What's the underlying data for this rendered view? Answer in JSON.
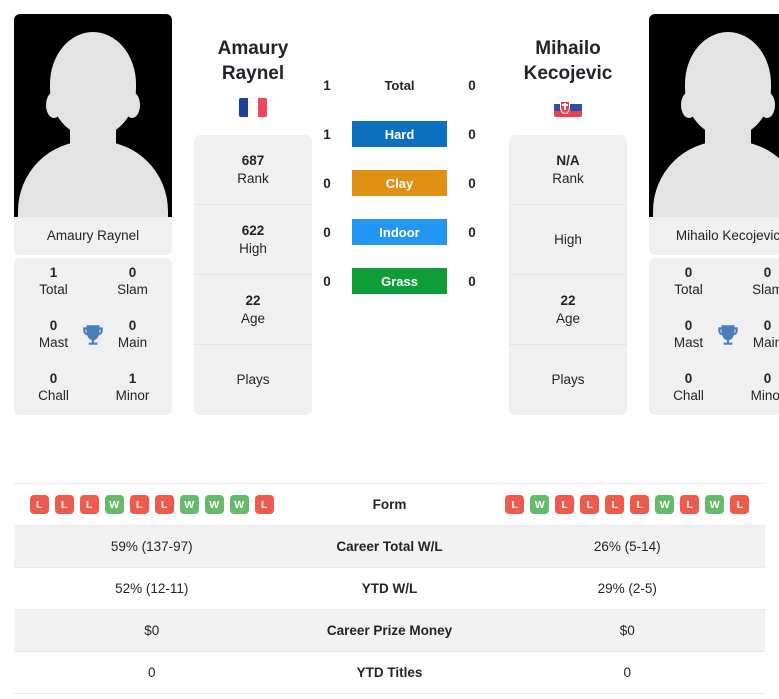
{
  "left_player": {
    "name_full": "Amaury Raynel",
    "name_line1": "Amaury",
    "name_line2": "Raynel",
    "country_flag": "fr-flag-icon",
    "photo_alt": "Amaury Raynel",
    "rank": {
      "value": "687",
      "label": "Rank"
    },
    "high": {
      "value": "622",
      "label": "High"
    },
    "age": {
      "value": "22",
      "label": "Age"
    },
    "plays": {
      "value": "",
      "label": "Plays"
    },
    "titles": {
      "total": {
        "value": "1",
        "label": "Total"
      },
      "slam": {
        "value": "0",
        "label": "Slam"
      },
      "mast": {
        "value": "0",
        "label": "Mast"
      },
      "main": {
        "value": "0",
        "label": "Main"
      },
      "chall": {
        "value": "0",
        "label": "Chall"
      },
      "minor": {
        "value": "1",
        "label": "Minor"
      }
    },
    "form": [
      "L",
      "L",
      "L",
      "W",
      "L",
      "L",
      "W",
      "W",
      "W",
      "L"
    ],
    "career_total_wl": "59% (137-97)",
    "ytd_wl": "52% (12-11)",
    "career_prize_money": "$0",
    "ytd_titles": "0"
  },
  "right_player": {
    "name_full": "Mihailo Kecojevic",
    "name_line1": "Mihailo",
    "name_line2": "Kecojevic",
    "country_flag": "sk-flag-icon",
    "photo_alt": "Mihailo Kecojevic",
    "rank": {
      "value": "N/A",
      "label": "Rank"
    },
    "high": {
      "value": "",
      "label": "High"
    },
    "age": {
      "value": "22",
      "label": "Age"
    },
    "plays": {
      "value": "",
      "label": "Plays"
    },
    "titles": {
      "total": {
        "value": "0",
        "label": "Total"
      },
      "slam": {
        "value": "0",
        "label": "Slam"
      },
      "mast": {
        "value": "0",
        "label": "Mast"
      },
      "main": {
        "value": "0",
        "label": "Main"
      },
      "chall": {
        "value": "0",
        "label": "Chall"
      },
      "minor": {
        "value": "0",
        "label": "Minor"
      }
    },
    "form": [
      "L",
      "W",
      "L",
      "L",
      "L",
      "L",
      "W",
      "L",
      "W",
      "L"
    ],
    "career_total_wl": "26% (5-14)",
    "ytd_wl": "29% (2-5)",
    "career_prize_money": "$0",
    "ytd_titles": "0"
  },
  "head_to_head": [
    {
      "label": "Total",
      "left": "1",
      "right": "0",
      "color": "",
      "style": "plain"
    },
    {
      "label": "Hard",
      "left": "1",
      "right": "0",
      "color": "#0d6fc0",
      "style": "badge"
    },
    {
      "label": "Clay",
      "left": "0",
      "right": "0",
      "color": "#e09112",
      "style": "badge"
    },
    {
      "label": "Indoor",
      "left": "0",
      "right": "0",
      "color": "#2196f3",
      "style": "badge"
    },
    {
      "label": "Grass",
      "left": "0",
      "right": "0",
      "color": "#0f9d3a",
      "style": "badge"
    }
  ],
  "stats_rows": [
    {
      "label": "Form",
      "key": "form",
      "type": "form"
    },
    {
      "label": "Career Total W/L",
      "key": "career_total_wl",
      "type": "text"
    },
    {
      "label": "YTD W/L",
      "key": "ytd_wl",
      "type": "text"
    },
    {
      "label": "Career Prize Money",
      "key": "career_prize_money",
      "type": "text"
    },
    {
      "label": "YTD Titles",
      "key": "ytd_titles",
      "type": "text"
    }
  ],
  "colors": {
    "win": "#66bb6a",
    "loss": "#ed5b4c",
    "hard": "#0d6fc0",
    "clay": "#e09112",
    "indoor": "#2196f3",
    "grass": "#0f9d3a",
    "panel": "#f0f0f0",
    "row_alt": "#f2f2f2",
    "trophy": "#4a7ebb"
  }
}
